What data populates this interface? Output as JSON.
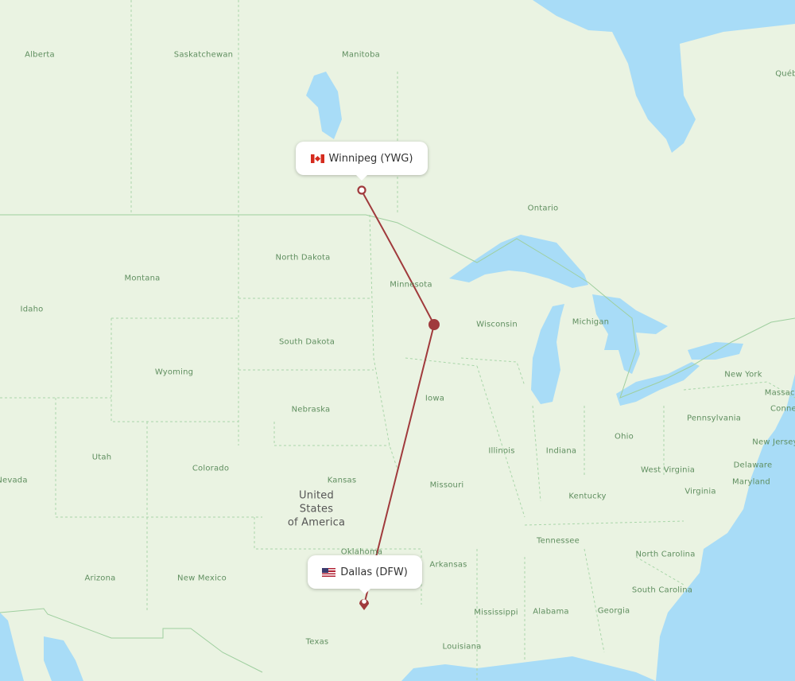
{
  "map": {
    "colors": {
      "land": "#eaf3e2",
      "water": "#a8dcf7",
      "route": "#a03a3c",
      "label": "#5f8e5f",
      "border": "#9fcf9f"
    },
    "origin": {
      "city": "Winnipeg",
      "code": "YWG",
      "label": "Winnipeg (YWG)",
      "flag": "canada-flag-icon"
    },
    "destination": {
      "city": "Dallas",
      "code": "DFW",
      "label": "Dallas (DFW)",
      "flag": "usa-flag-icon"
    },
    "country_label": "United\nStates\nof America",
    "region_labels": [
      {
        "name": "Alberta"
      },
      {
        "name": "Saskatchewan"
      },
      {
        "name": "Manitoba"
      },
      {
        "name": "Ontario"
      },
      {
        "name": "Québec"
      },
      {
        "name": "Montana"
      },
      {
        "name": "Idaho"
      },
      {
        "name": "North Dakota"
      },
      {
        "name": "Minnesota"
      },
      {
        "name": "Wisconsin"
      },
      {
        "name": "Michigan"
      },
      {
        "name": "South Dakota"
      },
      {
        "name": "Wyoming"
      },
      {
        "name": "Nebraska"
      },
      {
        "name": "Iowa"
      },
      {
        "name": "New York"
      },
      {
        "name": "Pennsylvania"
      },
      {
        "name": "New Jersey"
      },
      {
        "name": "Ohio"
      },
      {
        "name": "Indiana"
      },
      {
        "name": "Illinois"
      },
      {
        "name": "Utah"
      },
      {
        "name": "Colorado"
      },
      {
        "name": "Nevada"
      },
      {
        "name": "Kansas"
      },
      {
        "name": "Missouri"
      },
      {
        "name": "Kentucky"
      },
      {
        "name": "West Virginia"
      },
      {
        "name": "Virginia"
      },
      {
        "name": "Delaware"
      },
      {
        "name": "Maryland"
      },
      {
        "name": "Tennessee"
      },
      {
        "name": "North Carolina"
      },
      {
        "name": "South Carolina"
      },
      {
        "name": "Oklahoma"
      },
      {
        "name": "Arkansas"
      },
      {
        "name": "Arizona"
      },
      {
        "name": "New Mexico"
      },
      {
        "name": "Mississippi"
      },
      {
        "name": "Alabama"
      },
      {
        "name": "Georgia"
      },
      {
        "name": "Texas"
      },
      {
        "name": "Louisiana"
      },
      {
        "name": "Massachusetts"
      },
      {
        "name": "Connecticut"
      }
    ]
  }
}
